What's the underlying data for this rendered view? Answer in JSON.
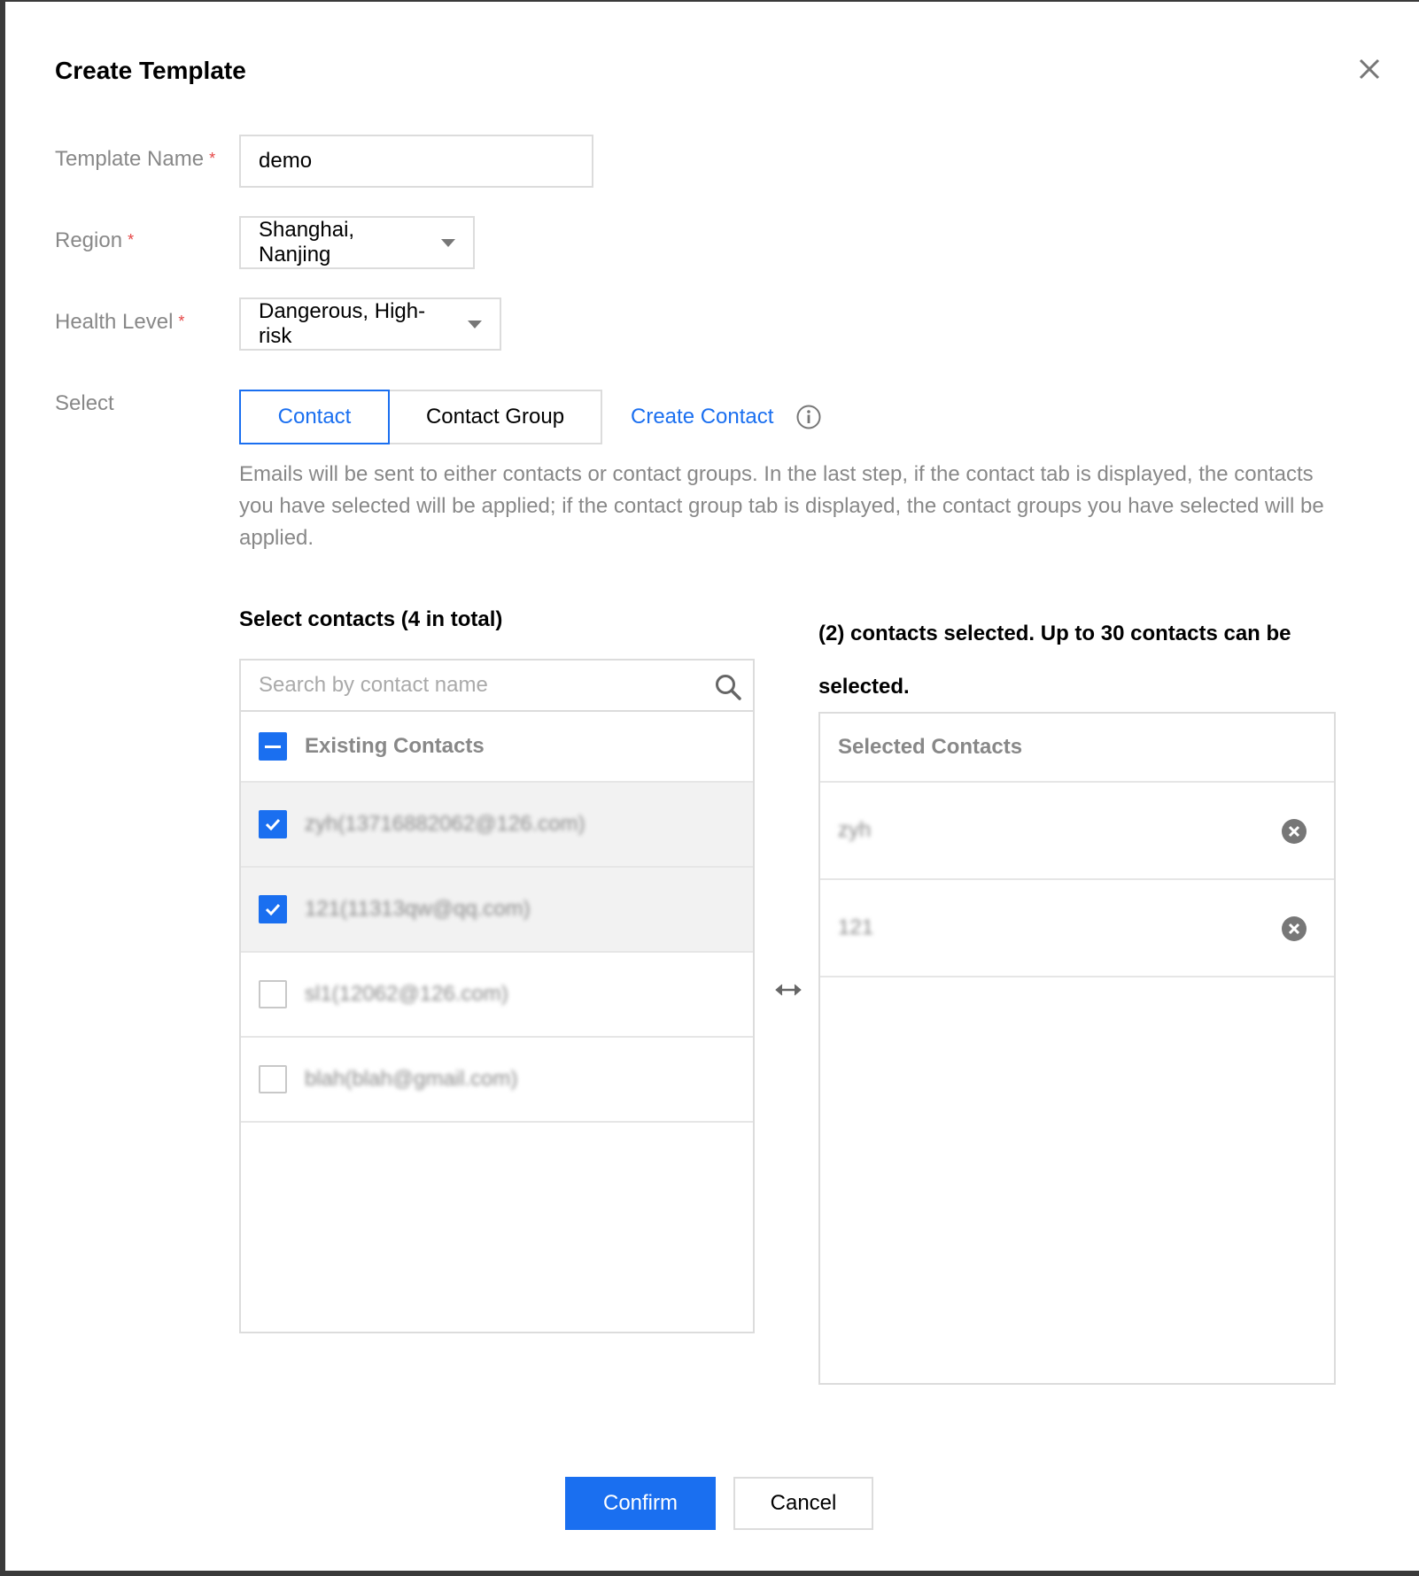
{
  "dialog": {
    "title": "Create Template"
  },
  "form": {
    "template_name": {
      "label": "Template Name",
      "required_mark": "*",
      "value": "demo"
    },
    "region": {
      "label": "Region",
      "required_mark": "*",
      "value": "Shanghai, Nanjing"
    },
    "health_level": {
      "label": "Health Level",
      "required_mark": "*",
      "value": "Dangerous, High-risk"
    },
    "select": {
      "label": "Select",
      "tabs": [
        {
          "label": "Contact",
          "active": true
        },
        {
          "label": "Contact Group",
          "active": false
        }
      ],
      "create_link": "Create Contact"
    },
    "description": "Emails will be sent to either contacts or contact groups. In the last step, if the contact tab is displayed, the contacts you have selected will be applied; if the contact group tab is displayed, the contact groups you have selected will be applied."
  },
  "source_list": {
    "title": "Select contacts (4 in total)",
    "search_placeholder": "Search by contact name",
    "header": {
      "label": "Existing Contacts",
      "state": "partial"
    },
    "items": [
      {
        "label": "zyh(13716882062@126.com)",
        "checked": true
      },
      {
        "label": "121(11313qw@qq.com)",
        "checked": true
      },
      {
        "label": "sl1(12062@126.com)",
        "checked": false
      },
      {
        "label": "blah(blah@gmail.com)",
        "checked": false
      }
    ]
  },
  "target_list": {
    "title": "(2) contacts selected. Up to 30 contacts can be selected.",
    "header": "Selected Contacts",
    "items": [
      {
        "label": "zyh"
      },
      {
        "label": "121"
      }
    ]
  },
  "footer": {
    "confirm": "Confirm",
    "cancel": "Cancel"
  },
  "colors": {
    "primary": "#1a6ff0",
    "required": "#e54545",
    "muted": "#888888"
  }
}
